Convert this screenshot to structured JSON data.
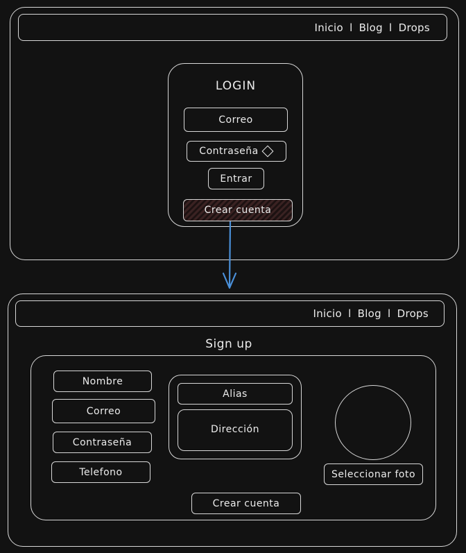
{
  "login_screen": {
    "nav": {
      "inicio": "Inicio",
      "sep1": "l",
      "blog": "Blog",
      "sep2": "l",
      "drops": "Drops"
    },
    "login_card": {
      "title": "LOGIN",
      "email_field": "Correo",
      "password_field": "Contraseña",
      "password_icon": "diamond-icon",
      "enter_button": "Entrar",
      "create_account_button": "Crear cuenta"
    }
  },
  "signup_screen": {
    "nav": {
      "inicio": "Inicio",
      "sep1": "l",
      "blog": "Blog",
      "sep2": "l",
      "drops": "Drops"
    },
    "title": "Sign up",
    "fields": {
      "name": "Nombre",
      "email": "Correo",
      "password": "Contraseña",
      "phone": "Telefono",
      "alias": "Alias",
      "address": "Dirección"
    },
    "select_photo_button": "Seleccionar foto",
    "create_account_button": "Crear cuenta"
  },
  "colors": {
    "stroke": "#d8d8d8",
    "arrow": "#4a90d9",
    "background": "#121212",
    "hatch": "#3a2222"
  }
}
